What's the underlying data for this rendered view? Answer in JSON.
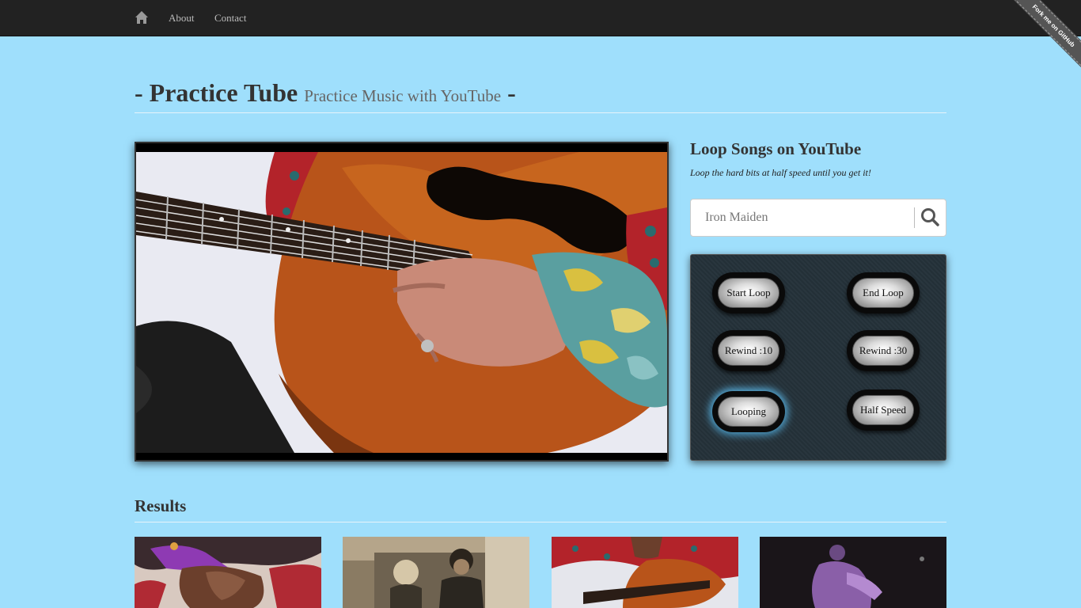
{
  "nav": {
    "home_icon": "home-icon",
    "about": "About",
    "contact": "Contact",
    "ribbon": "Fork me on GitHub"
  },
  "header": {
    "title": "Practice Tube",
    "subtitle": "Practice Music with YouTube",
    "prefix": "- ",
    "suffix": " -"
  },
  "side": {
    "title": "Loop Songs on YouTube",
    "subtitle": "Loop the hard bits at half speed until you get it!"
  },
  "search": {
    "placeholder": "Iron Maiden",
    "value": "",
    "icon": "search-icon"
  },
  "controls": {
    "start_loop": "Start Loop",
    "end_loop": "End Loop",
    "rewind_10": "Rewind :10",
    "rewind_30": "Rewind :30",
    "looping": "Looping",
    "half_speed": "Half Speed",
    "active_color": "#5ab5e5"
  },
  "results": {
    "title": "Results"
  },
  "colors": {
    "background": "#9fdffc",
    "navbar": "#222222",
    "panel": "#25323a"
  }
}
